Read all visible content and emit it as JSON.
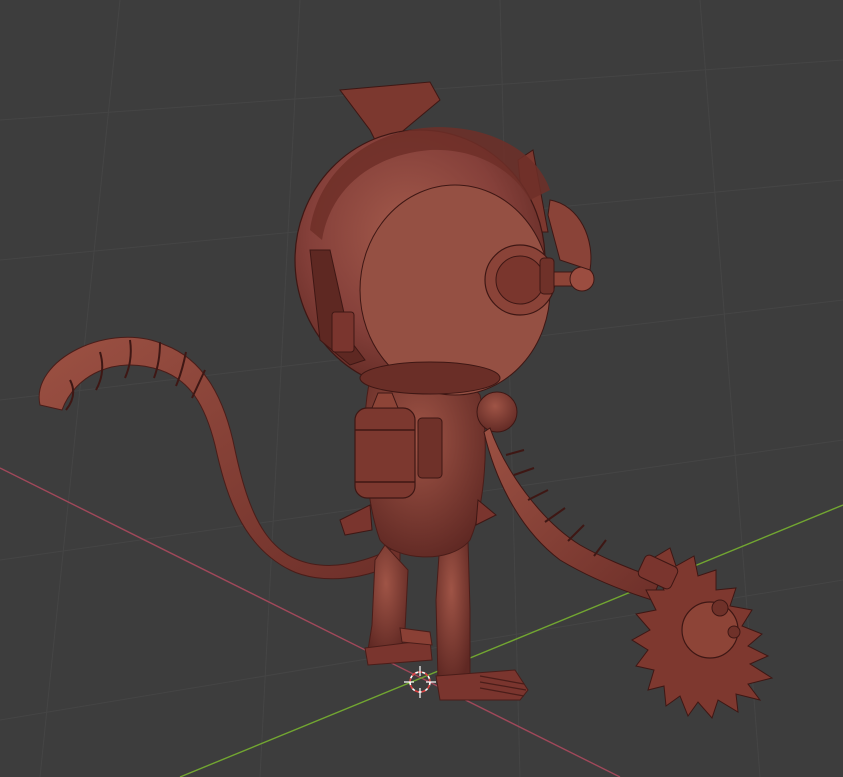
{
  "viewport": {
    "background": "#3d3d3d",
    "grid_line_color": "#474747",
    "x_axis_color": "#9b4150",
    "y_axis_color": "#6a9a2a",
    "model_color": "#8a3f37",
    "model_highlight": "#a85a4c",
    "model_shadow": "#5a2520"
  },
  "scene": {
    "object": "sculpted-monkey-robot-character",
    "cursor_icon": "3d-cursor-icon"
  }
}
